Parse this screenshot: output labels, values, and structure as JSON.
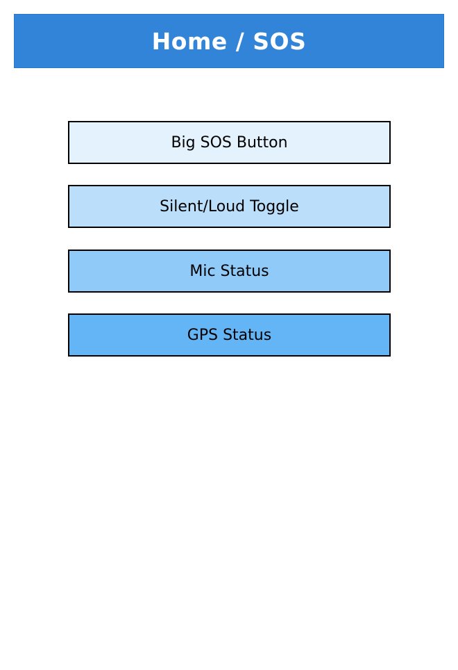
{
  "header": {
    "title": "Home / SOS",
    "color": "#3184d8"
  },
  "items": [
    {
      "label": "Big SOS Button",
      "color": "#e3f2fd"
    },
    {
      "label": "Silent/Loud Toggle",
      "color": "#bbdefb"
    },
    {
      "label": "Mic Status",
      "color": "#90caf9"
    },
    {
      "label": "GPS Status",
      "color": "#64b5f6"
    }
  ]
}
